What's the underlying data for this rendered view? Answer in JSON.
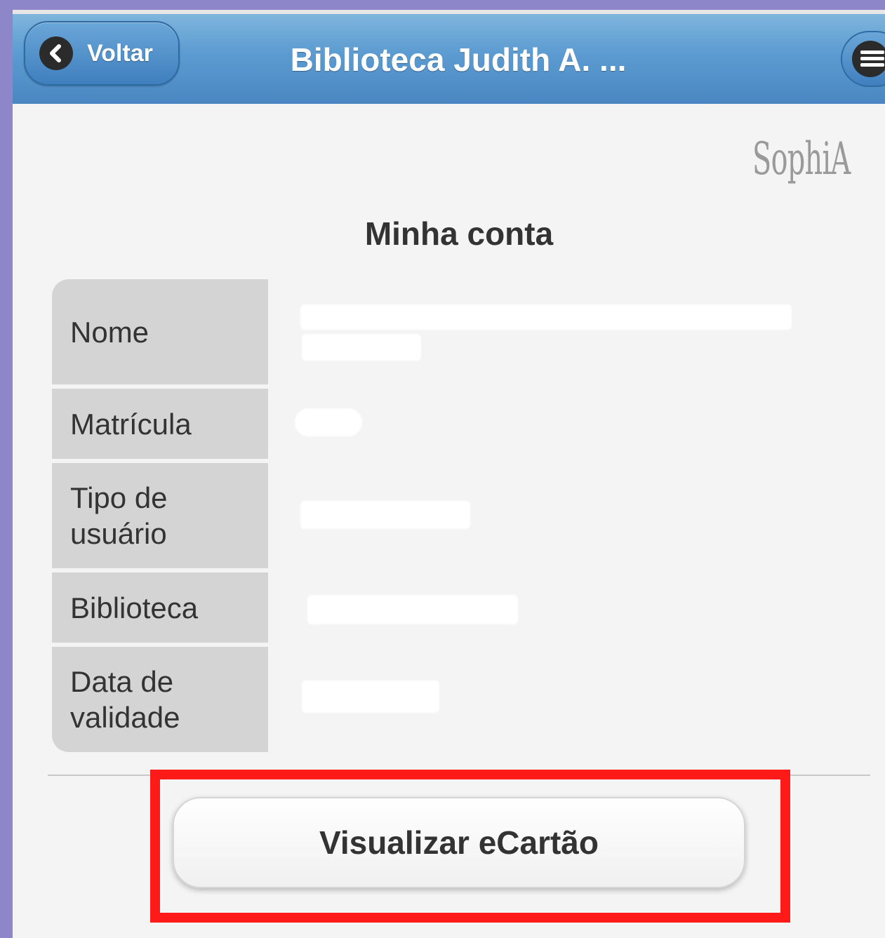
{
  "header": {
    "back_label": "Voltar",
    "title": "Biblioteca Judith A. ..."
  },
  "icons": {
    "back": "chevron-left-icon",
    "menu": "menu-icon"
  },
  "logo": {
    "text": "SophiA"
  },
  "page": {
    "title": "Minha conta"
  },
  "account_fields": [
    {
      "label": "Nome",
      "value": ""
    },
    {
      "label": "Matrícula",
      "value": ""
    },
    {
      "label": "Tipo de usuário",
      "value": ""
    },
    {
      "label": "Biblioteca",
      "value": ""
    },
    {
      "label": "Data de validade",
      "value": ""
    }
  ],
  "actions": {
    "ecard_label": "Visualizar eCartão"
  },
  "colors": {
    "header_blue": "#5b9bd1",
    "highlight_red": "#ff1a1a",
    "frame_purple": "#8d86c9"
  }
}
